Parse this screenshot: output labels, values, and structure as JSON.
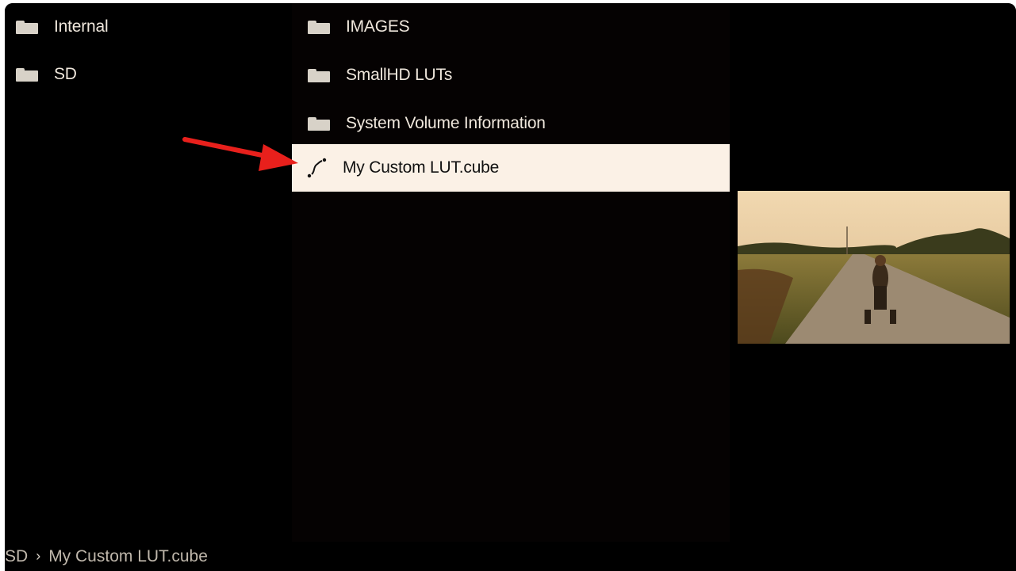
{
  "left_pane": {
    "items": [
      {
        "label": "Internal",
        "icon": "folder-icon"
      },
      {
        "label": "SD",
        "icon": "folder-icon"
      }
    ]
  },
  "middle_pane": {
    "items": [
      {
        "label": "IMAGES",
        "icon": "folder-icon"
      },
      {
        "label": "SmallHD LUTs",
        "icon": "folder-icon"
      },
      {
        "label": "System Volume Information",
        "icon": "folder-icon"
      },
      {
        "label": "My Custom LUT.cube",
        "icon": "lut-curve-icon",
        "selected": true
      }
    ]
  },
  "preview": {
    "icon": "preview-thumbnail"
  },
  "statusbar": {
    "path": [
      "SD",
      "My Custom LUT.cube"
    ],
    "separator_icon": "chevron-right-icon"
  },
  "colors": {
    "selection_bg": "#fbf1e6",
    "annotation_arrow": "#e8201c"
  }
}
